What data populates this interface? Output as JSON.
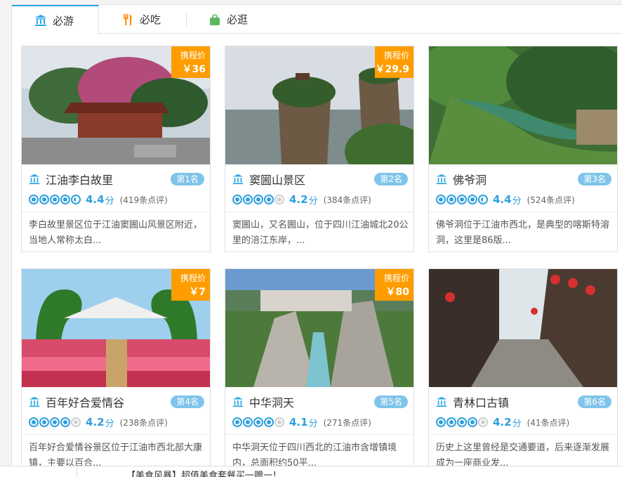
{
  "tabs": [
    {
      "label": "必游",
      "icon": "bank-icon",
      "active": true
    },
    {
      "label": "必吃",
      "icon": "fork-knife-icon",
      "active": false
    },
    {
      "label": "必逛",
      "icon": "shopping-bag-icon",
      "active": false
    }
  ],
  "price_label": "携程价",
  "cards": [
    {
      "name": "江油李白故里",
      "rank": "第1名",
      "price": "￥36",
      "score": "4.4",
      "unit": "分",
      "reviews": "(419条点评)",
      "desc": "李白故里景区位于江油窦圌山风景区附近，当地人常称太白...",
      "stars": [
        1,
        1,
        1,
        1,
        0.5
      ]
    },
    {
      "name": "窦圌山景区",
      "rank": "第2名",
      "price": "￥29.9",
      "score": "4.2",
      "unit": "分",
      "reviews": "(384条点评)",
      "desc": "窦圌山，又名圌山，位于四川江油城北20公里的涪江东岸，...",
      "stars": [
        1,
        1,
        1,
        1,
        0
      ]
    },
    {
      "name": "佛爷洞",
      "rank": "第3名",
      "price": "",
      "score": "4.4",
      "unit": "分",
      "reviews": "(524条点评)",
      "desc": "佛爷洞位于江油市西北，是典型的喀斯特溶洞，这里是86版...",
      "stars": [
        1,
        1,
        1,
        1,
        0.5
      ]
    },
    {
      "name": "百年好合爱情谷",
      "rank": "第4名",
      "price": "￥7",
      "score": "4.2",
      "unit": "分",
      "reviews": "(238条点评)",
      "desc": "百年好合爱情谷景区位于江油市西北部大康镇，主要以百合...",
      "stars": [
        1,
        1,
        1,
        1,
        0
      ]
    },
    {
      "name": "中华洞天",
      "rank": "第5名",
      "price": "￥80",
      "score": "4.1",
      "unit": "分",
      "reviews": "(271条点评)",
      "desc": "中华洞天位于四川西北的江油市含增镇境内，总面积约50平...",
      "stars": [
        1,
        1,
        1,
        1,
        0
      ]
    },
    {
      "name": "青林口古镇",
      "rank": "第6名",
      "price": "",
      "score": "4.2",
      "unit": "分",
      "reviews": "(41条点评)",
      "desc": "历史上这里曾经是交通要道，后来逐渐发展成为一座商业发...",
      "stars": [
        1,
        1,
        1,
        1,
        0
      ]
    }
  ],
  "bottom_bar": {
    "text": "【美食风暴】超值美食套餐买一赠一！"
  },
  "colors": {
    "accent": "#2aa7e6",
    "price_tag": "#ff9d00",
    "rank_badge": "#7fc4ea",
    "rating": "#2ea0dc"
  }
}
